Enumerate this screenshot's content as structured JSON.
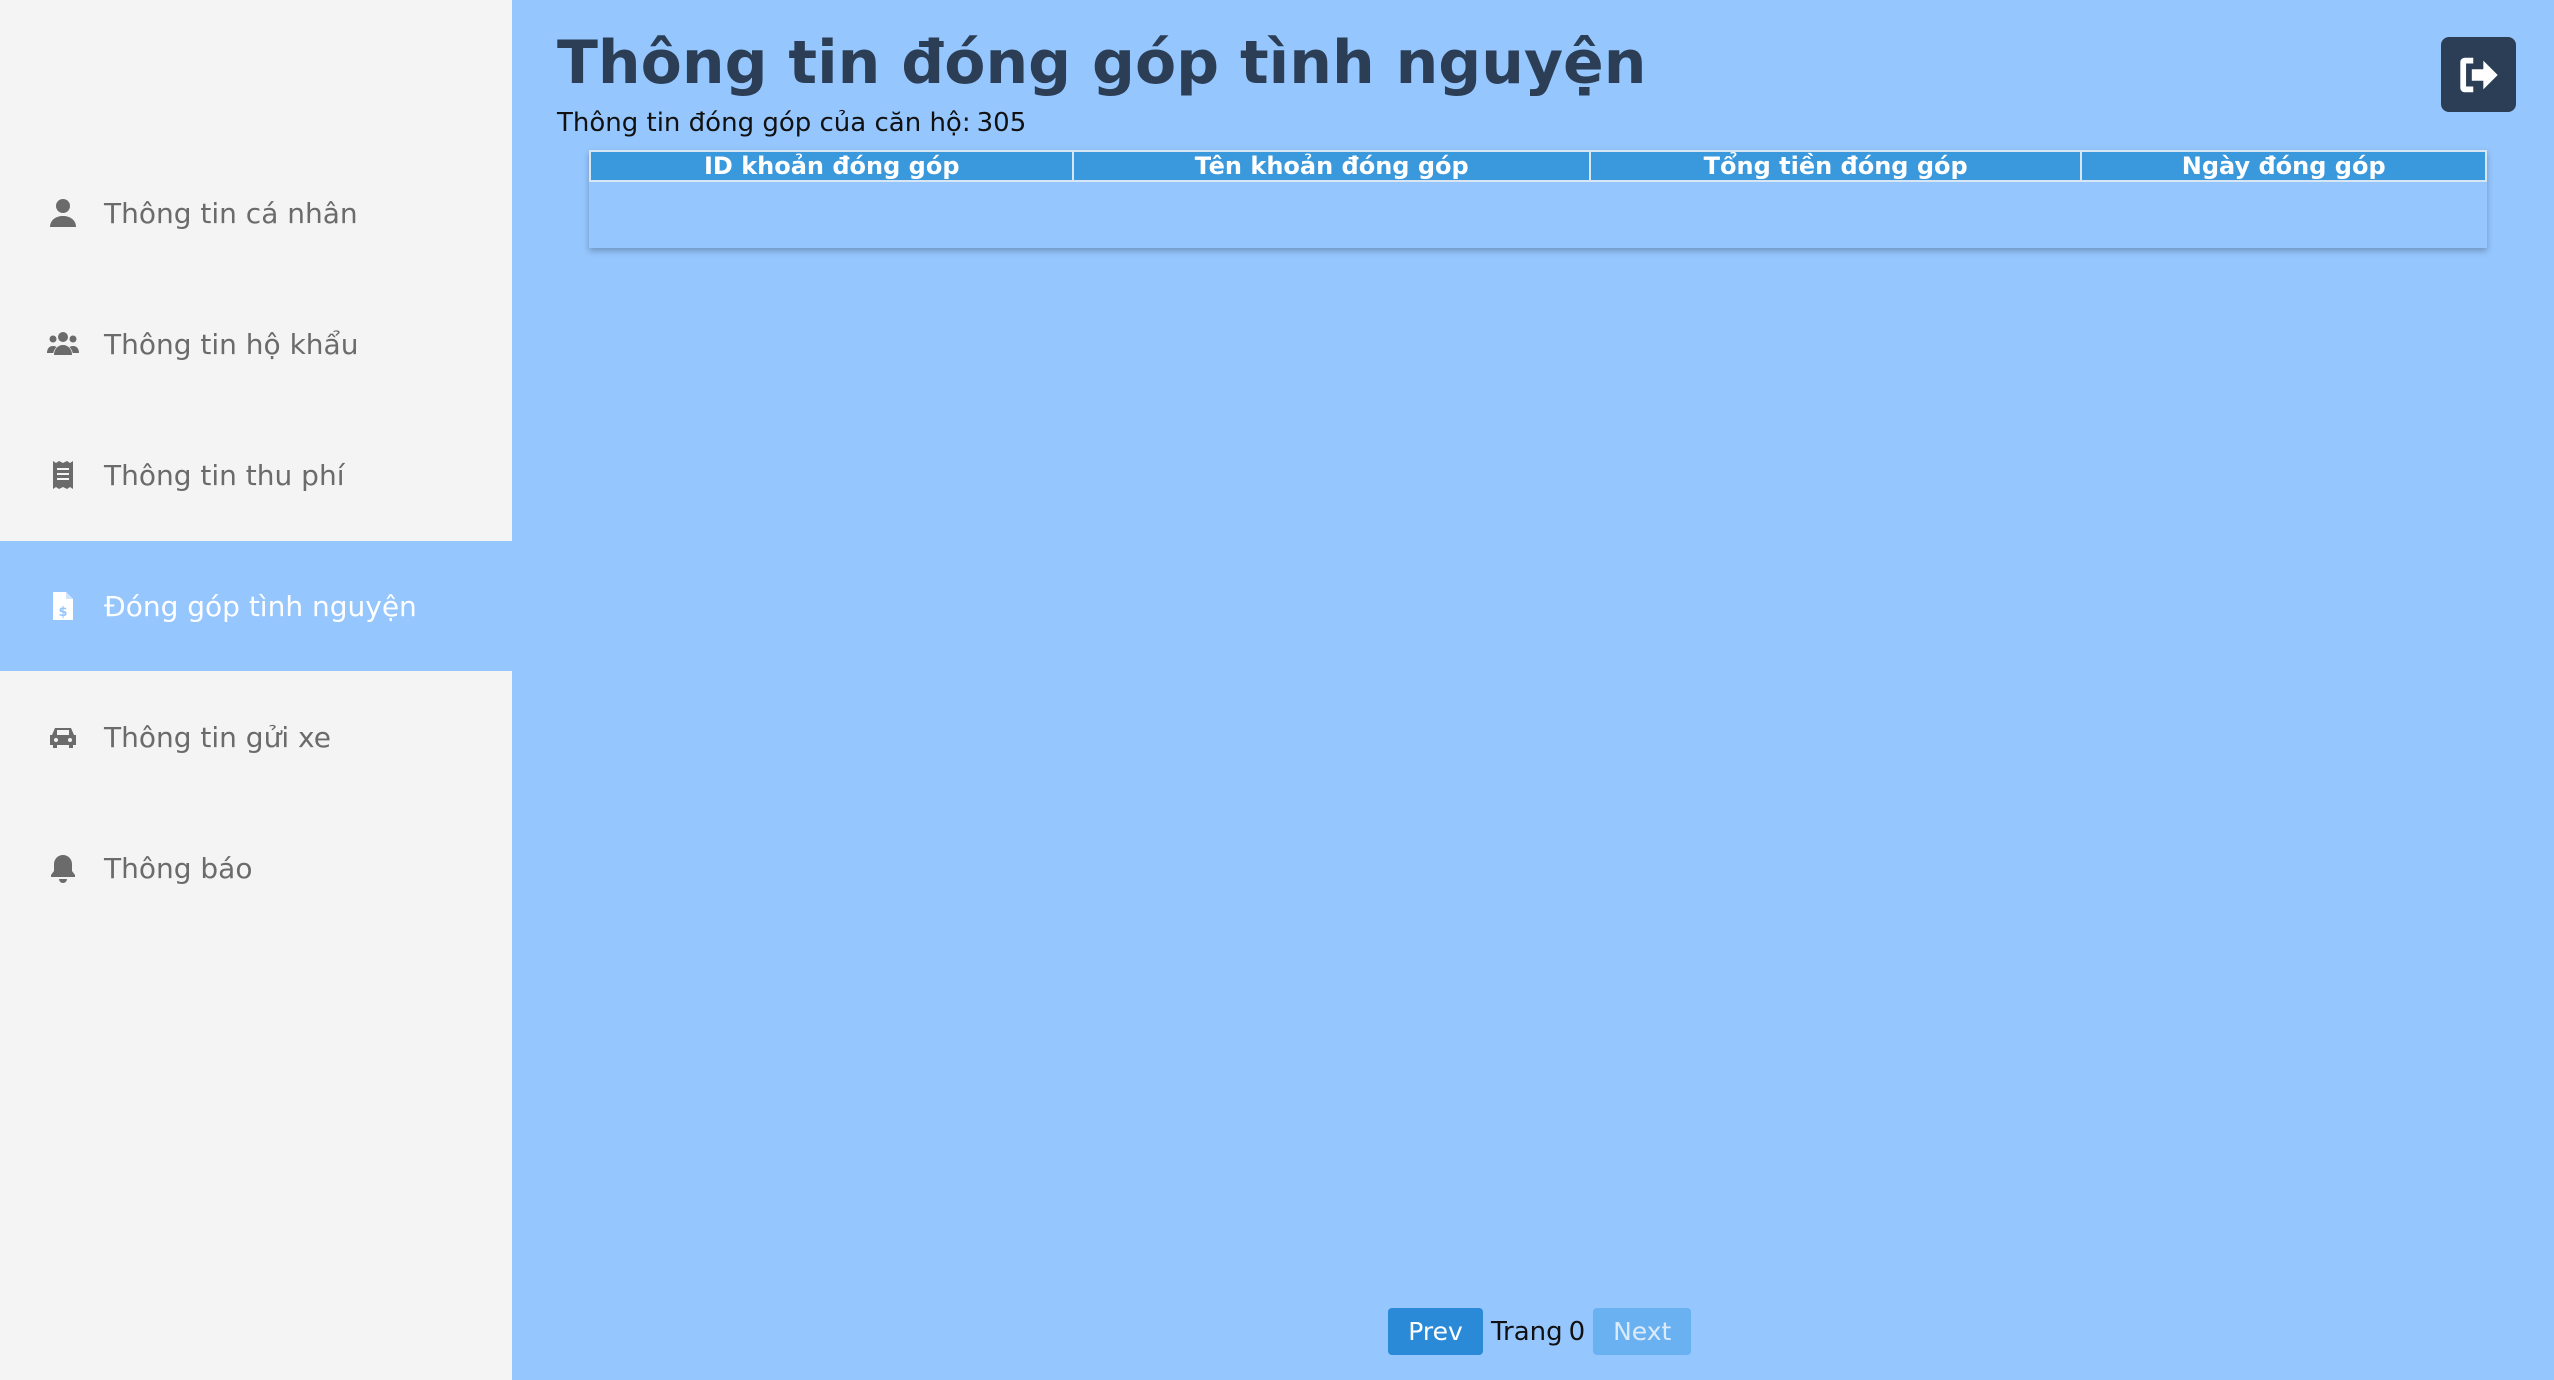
{
  "sidebar": {
    "items": [
      {
        "label": "Thông tin cá nhân",
        "icon": "user-icon",
        "active": false
      },
      {
        "label": "Thông tin hộ khẩu",
        "icon": "users-icon",
        "active": false
      },
      {
        "label": "Thông tin thu phí",
        "icon": "receipt-icon",
        "active": false
      },
      {
        "label": "Đóng góp tình nguyện",
        "icon": "invoice-dollar-icon",
        "active": true
      },
      {
        "label": "Thông tin gửi xe",
        "icon": "car-icon",
        "active": false
      },
      {
        "label": "Thông báo",
        "icon": "bell-icon",
        "active": false
      }
    ]
  },
  "header": {
    "title": "Thông tin đóng góp tình nguyện",
    "subtitle_label": "Thông tin đóng góp của căn hộ:",
    "apartment": "305",
    "logout_icon": "sign-out-icon"
  },
  "table": {
    "columns": [
      "ID khoản đóng góp",
      "Tên khoản đóng góp",
      "Tổng tiền đóng góp",
      "Ngày đóng góp"
    ],
    "rows": []
  },
  "pagination": {
    "prev_label": "Prev",
    "page_label": "Trang",
    "page_number": "0",
    "next_label": "Next"
  },
  "colors": {
    "sidebar_bg": "#f4f4f4",
    "main_bg": "#95c6fe",
    "active_item_bg": "#95c6fe",
    "table_header_bg": "#3a98dc",
    "title_color": "#2c3e55",
    "logout_bg": "#2c3e55",
    "prev_bg": "#2b8ad8",
    "next_bg": "#69b1f1"
  }
}
